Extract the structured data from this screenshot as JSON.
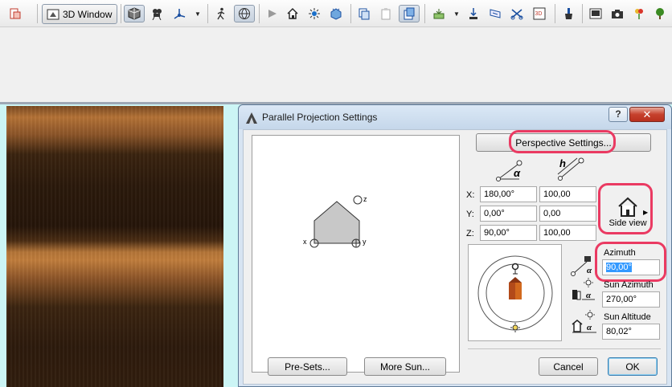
{
  "toolbar": {
    "window_button_label": "3D Window",
    "icons": [
      "layout-icon",
      "cube-icon",
      "camera-icon",
      "axis-icon",
      "walk-icon",
      "globe-icon",
      "arrow-icon",
      "house-icon",
      "sun-icon",
      "crystal-icon",
      "copy-icon",
      "paste-icon",
      "stack-icon",
      "render-icon",
      "dropper-icon",
      "perspective-icon",
      "scissors-icon",
      "3d-box-icon",
      "brush-icon",
      "image-icon",
      "photo-icon",
      "flower-icon"
    ]
  },
  "dialog": {
    "title": "Parallel Projection Settings",
    "help_label": "?",
    "close_label": "✕",
    "perspective_button": "Perspective Settings...",
    "preview_axes": {
      "x": "x",
      "y": "y",
      "z": "z"
    },
    "coords": {
      "header_angle": "α",
      "header_length": "h",
      "rows": [
        {
          "label": "X:",
          "angle": "180,00°",
          "length": "100,00"
        },
        {
          "label": "Y:",
          "angle": "0,00°",
          "length": "0,00"
        },
        {
          "label": "Z:",
          "angle": "90,00°",
          "length": "100,00"
        }
      ]
    },
    "view_preset": {
      "label": "Side view"
    },
    "sun": {
      "azimuth_label": "Azimuth",
      "azimuth_value": "90,00°",
      "sun_azimuth_label": "Sun Azimuth",
      "sun_azimuth_value": "270,00°",
      "sun_altitude_label": "Sun Altitude",
      "sun_altitude_value": "80,02°"
    },
    "buttons": {
      "presets": "Pre-Sets...",
      "more_sun": "More Sun...",
      "cancel": "Cancel",
      "ok": "OK"
    }
  },
  "colors": {
    "annotation": "#ea3a62",
    "selection": "#3399ff",
    "view_background": "#ccf5f5"
  }
}
